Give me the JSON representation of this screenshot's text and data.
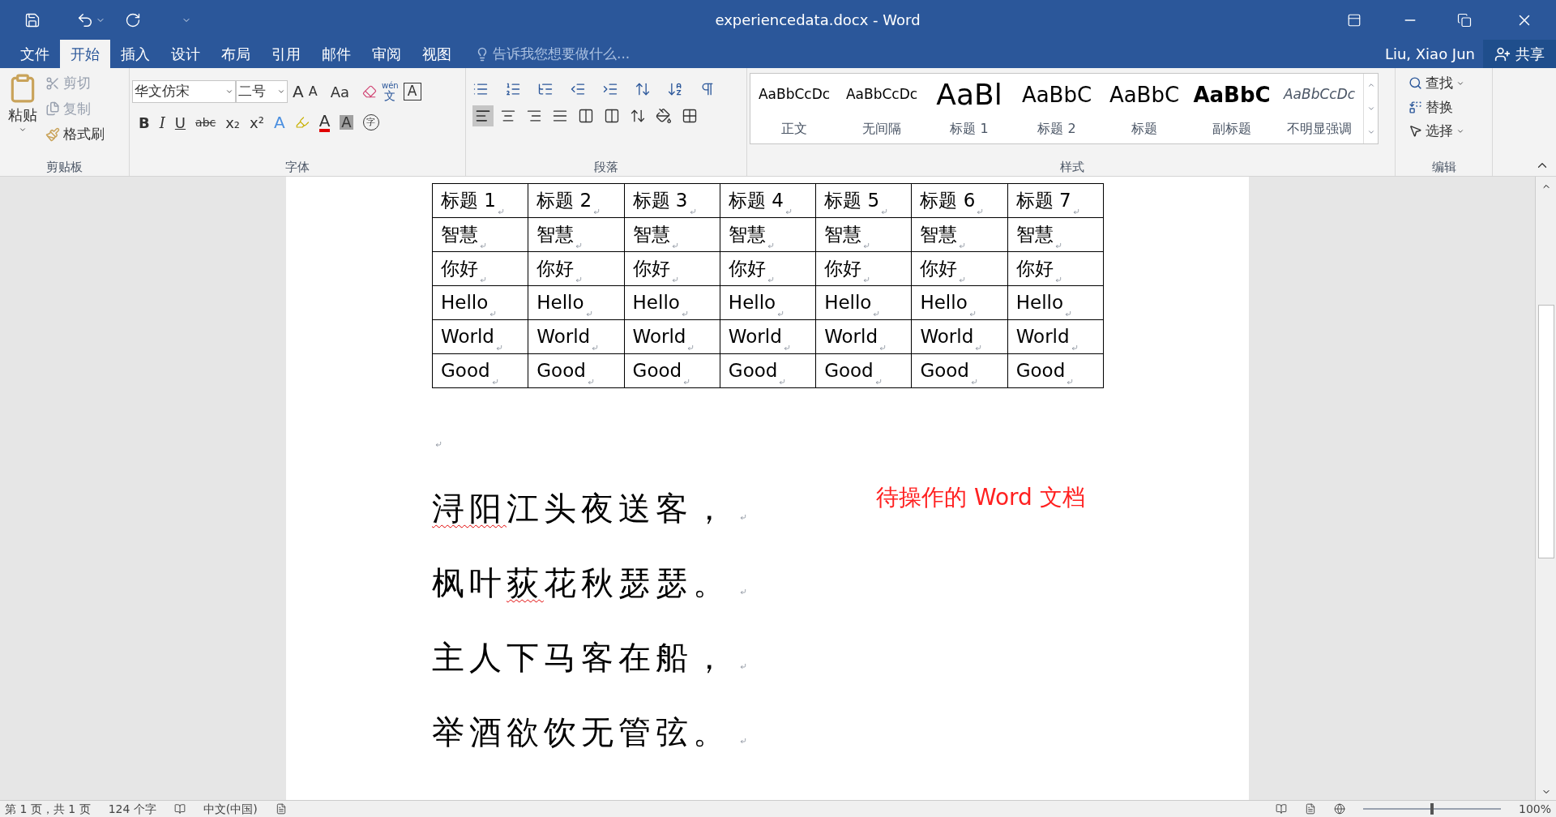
{
  "window": {
    "title": "experiencedata.docx - Word"
  },
  "tabs": [
    {
      "label": "文件",
      "selected": false
    },
    {
      "label": "开始",
      "selected": true
    },
    {
      "label": "插入",
      "selected": false
    },
    {
      "label": "设计",
      "selected": false
    },
    {
      "label": "布局",
      "selected": false
    },
    {
      "label": "引用",
      "selected": false
    },
    {
      "label": "邮件",
      "selected": false
    },
    {
      "label": "审阅",
      "selected": false
    },
    {
      "label": "视图",
      "selected": false
    }
  ],
  "tell_me": {
    "placeholder": "告诉我您想要做什么..."
  },
  "user": "Liu, Xiao Jun",
  "share": "共享",
  "clipboard": {
    "paste": "粘贴",
    "cut": "剪切",
    "copy": "复制",
    "format_painter": "格式刷",
    "label": "剪贴板"
  },
  "font": {
    "name": "华文仿宋",
    "size": "二号",
    "grow": "A",
    "shrink": "A",
    "case": "Aa",
    "phonetic_top": "wén",
    "phonetic_bottom": "文",
    "border": "A",
    "bold": "B",
    "italic": "I",
    "underline": "U",
    "strike": "abc",
    "subscript": "x₂",
    "superscript": "x²",
    "effects": "A",
    "font_color": "A",
    "shading": "A",
    "enclose": "字",
    "label": "字体"
  },
  "paragraph": {
    "label": "段落"
  },
  "styles": {
    "label": "样式",
    "items": [
      {
        "preview": "AaBbCcDc",
        "label": "正文",
        "kind": "normal",
        "selected": false
      },
      {
        "preview": "AaBbCcDc",
        "label": "无间隔",
        "kind": "normal",
        "selected": false
      },
      {
        "preview": "AaBl",
        "label": "标题 1",
        "kind": "heading1",
        "selected": false
      },
      {
        "preview": "AaBbC",
        "label": "标题 2",
        "kind": "heading2",
        "selected": false
      },
      {
        "preview": "AaBbC",
        "label": "标题",
        "kind": "title",
        "selected": false
      },
      {
        "preview": "AaBbC",
        "label": "副标题",
        "kind": "subtitle",
        "selected": false
      },
      {
        "preview": "AaBbCcDc",
        "label": "不明显强调",
        "kind": "emphasis",
        "selected": false
      }
    ]
  },
  "editing": {
    "label": "编辑",
    "find": "查找",
    "replace": "替换",
    "select": "选择"
  },
  "table": {
    "rows": [
      [
        "标题 1",
        "标题 2",
        "标题 3",
        "标题 4",
        "标题 5",
        "标题 6",
        "标题 7"
      ],
      [
        "智慧",
        "智慧",
        "智慧",
        "智慧",
        "智慧",
        "智慧",
        "智慧"
      ],
      [
        "你好",
        "你好",
        "你好",
        "你好",
        "你好",
        "你好",
        "你好"
      ],
      [
        "Hello",
        "Hello",
        "Hello",
        "Hello",
        "Hello",
        "Hello",
        "Hello"
      ],
      [
        "World",
        "World",
        "World",
        "World",
        "World",
        "World",
        "World"
      ],
      [
        "Good",
        "Good",
        "Good",
        "Good",
        "Good",
        "Good",
        "Good"
      ]
    ]
  },
  "poem": [
    [
      {
        "text": "浔阳",
        "flagged": true
      },
      {
        "text": "江头夜送客，",
        "flagged": false
      }
    ],
    [
      {
        "text": "枫叶",
        "flagged": false
      },
      {
        "text": "荻",
        "flagged": true
      },
      {
        "text": "花秋瑟瑟。",
        "flagged": false
      }
    ],
    [
      {
        "text": "主人下马客在船，",
        "flagged": false
      }
    ],
    [
      {
        "text": "举酒欲饮无管弦。",
        "flagged": false
      }
    ]
  ],
  "annotation": "待操作的 Word 文档",
  "status_bar": {
    "page": "第 1 页，共 1 页",
    "words": "124 个字",
    "language": "中文(中国)",
    "zoom": "100%",
    "zoom_slider": {
      "level": 0.5
    }
  }
}
